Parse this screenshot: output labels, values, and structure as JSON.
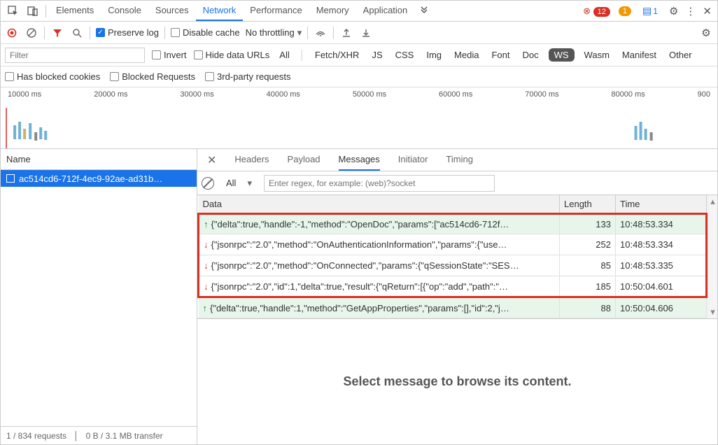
{
  "tabs": {
    "items": [
      "Elements",
      "Console",
      "Sources",
      "Network",
      "Performance",
      "Memory",
      "Application"
    ],
    "active": "Network",
    "errors": 12,
    "warnings": 1,
    "messages": 1
  },
  "toolbar": {
    "preserve_log": "Preserve log",
    "disable_cache": "Disable cache",
    "throttling": "No throttling"
  },
  "filters": {
    "placeholder": "Filter",
    "invert": "Invert",
    "hide_data_urls": "Hide data URLs",
    "types": [
      "All",
      "Fetch/XHR",
      "JS",
      "CSS",
      "Img",
      "Media",
      "Font",
      "Doc",
      "WS",
      "Wasm",
      "Manifest",
      "Other"
    ],
    "active_type": "WS",
    "has_blocked_cookies": "Has blocked cookies",
    "blocked_requests": "Blocked Requests",
    "third_party": "3rd-party requests"
  },
  "timeline": {
    "ticks": [
      "10000 ms",
      "20000 ms",
      "30000 ms",
      "40000 ms",
      "50000 ms",
      "60000 ms",
      "70000 ms",
      "80000 ms",
      "900"
    ]
  },
  "name_panel": {
    "header": "Name",
    "row": "ac514cd6-712f-4ec9-92ae-ad31b…"
  },
  "status": {
    "requests": "1 / 834 requests",
    "transfer": "0 B / 3.1 MB transfer"
  },
  "detail_tabs": {
    "items": [
      "Headers",
      "Payload",
      "Messages",
      "Initiator",
      "Timing"
    ],
    "active": "Messages"
  },
  "msg_filter": {
    "all": "All",
    "regex_placeholder": "Enter regex, for example: (web)?socket"
  },
  "msg_table": {
    "headers": {
      "data": "Data",
      "length": "Length",
      "time": "Time"
    },
    "rows": [
      {
        "dir": "up",
        "data": "{\"delta\":true,\"handle\":-1,\"method\":\"OpenDoc\",\"params\":[\"ac514cd6-712f…",
        "length": 133,
        "time": "10:48:53.334",
        "hl": true
      },
      {
        "dir": "down",
        "data": "{\"jsonrpc\":\"2.0\",\"method\":\"OnAuthenticationInformation\",\"params\":{\"use…",
        "length": 252,
        "time": "10:48:53.334",
        "hl": true
      },
      {
        "dir": "down",
        "data": "{\"jsonrpc\":\"2.0\",\"method\":\"OnConnected\",\"params\":{\"qSessionState\":\"SES…",
        "length": 85,
        "time": "10:48:53.335",
        "hl": true
      },
      {
        "dir": "down",
        "data": "{\"jsonrpc\":\"2.0\",\"id\":1,\"delta\":true,\"result\":{\"qReturn\":[{\"op\":\"add\",\"path\":\"…",
        "length": 185,
        "time": "10:50:04.601",
        "hl": true
      },
      {
        "dir": "up",
        "data": "{\"delta\":true,\"handle\":1,\"method\":\"GetAppProperties\",\"params\":[],\"id\":2,\"j…",
        "length": 88,
        "time": "10:50:04.606",
        "hl": false
      }
    ]
  },
  "bottom_msg": "Select message to browse its content."
}
